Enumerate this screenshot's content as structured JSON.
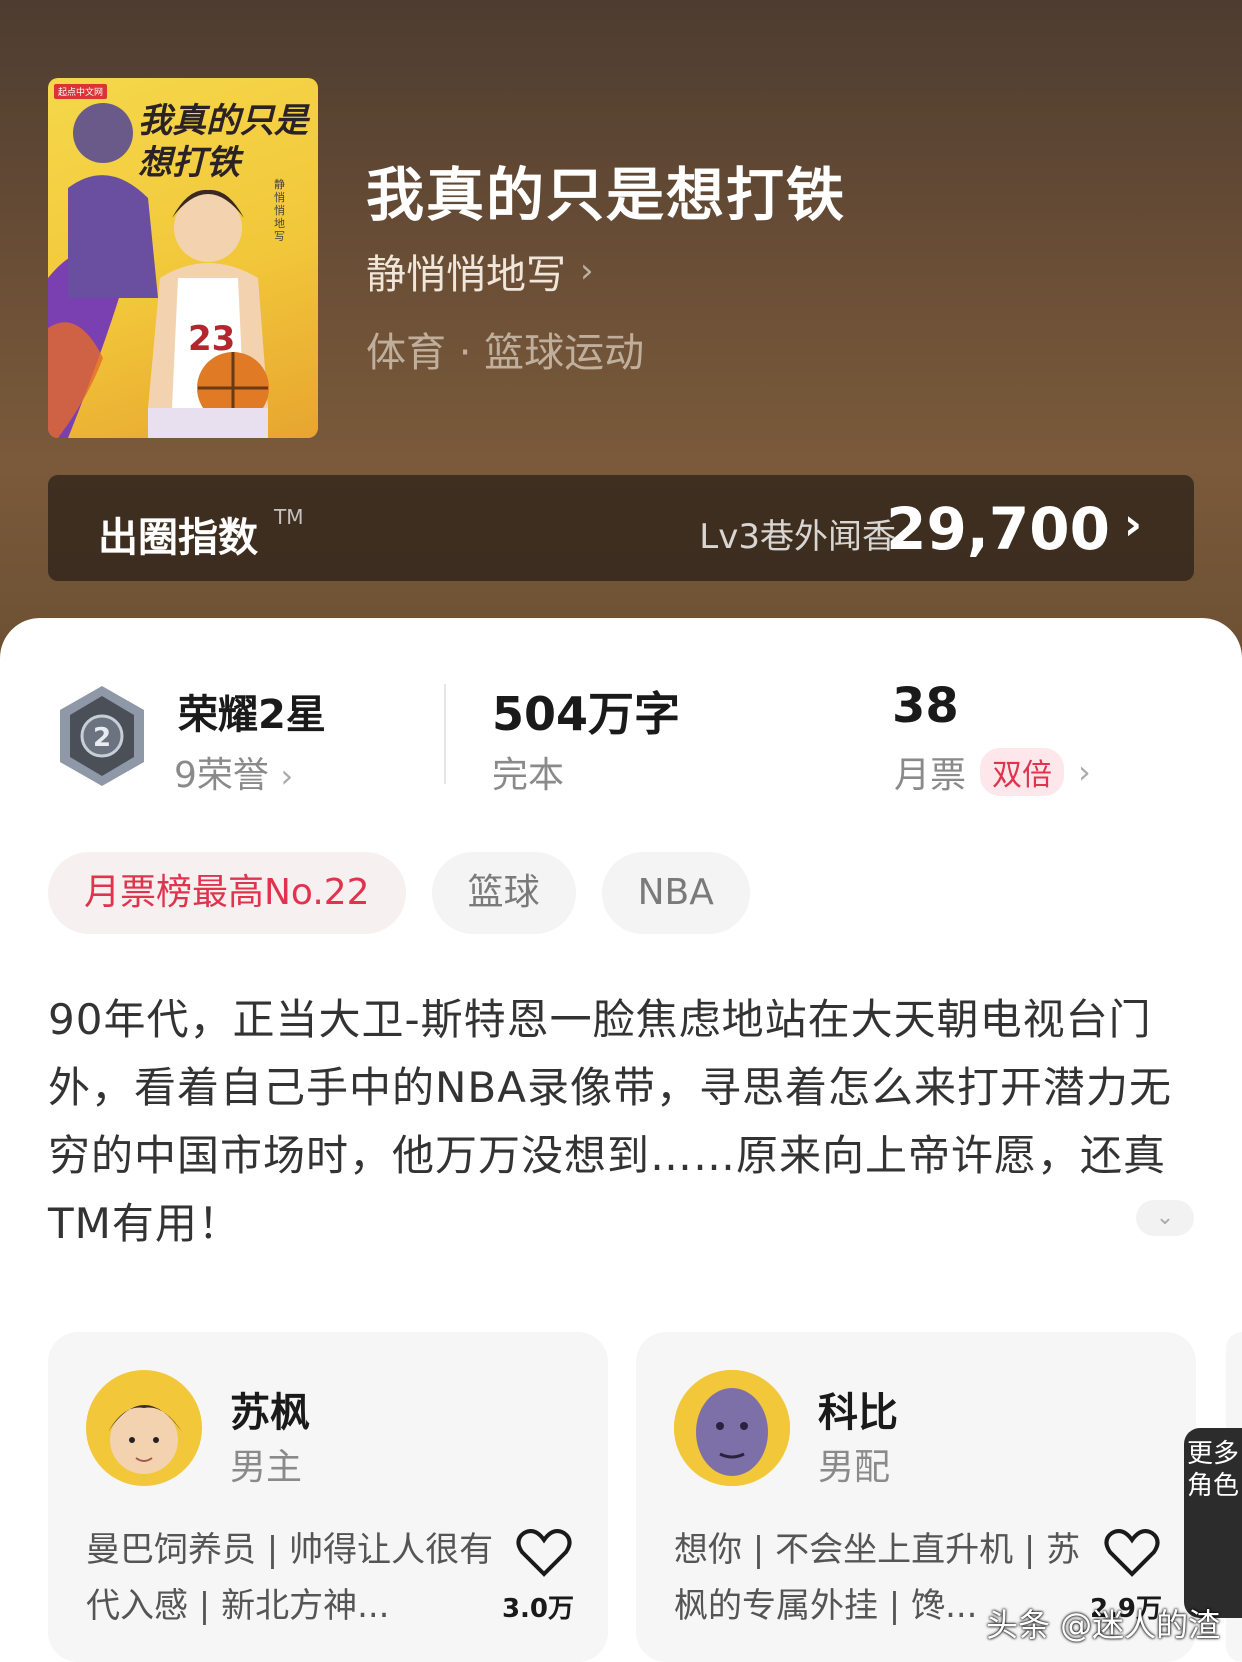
{
  "book": {
    "title": "我真的只是想打铁",
    "author": "静悄悄地写",
    "genre": "体育 · 篮球运动",
    "cover": {
      "publisher": "起点中文网",
      "title_art": "我真的只是想打铁",
      "author_art": "静悄悄地写",
      "jersey": "23"
    }
  },
  "index": {
    "label": "出圈指数",
    "tm": "TM",
    "level": "Lv3巷外闻香",
    "value": "29,700"
  },
  "stats": {
    "honor_title": "荣耀2星",
    "honor_count": "9荣誉",
    "medal_number": "2",
    "words": "504万字",
    "status": "完本",
    "votes": "38",
    "votes_label": "月票",
    "double_badge": "双倍"
  },
  "tags": [
    "月票榜最高No.22",
    "篮球",
    "NBA"
  ],
  "intro": "90年代，正当大卫-斯特恩一脸焦虑地站在大天朝电视台门外，看着自己手中的NBA录像带，寻思着怎么来打开潜力无穷的中国市场时，他万万没想到……原来向上帝许愿，还真TM有用！",
  "characters": [
    {
      "name": "苏枫",
      "role": "男主",
      "desc": "曼巴饲养员 | 帅得让人很有代入感 | 新北方神...",
      "likes": "3.0万"
    },
    {
      "name": "科比",
      "role": "男配",
      "desc": "想你 | 不会坐上直升机 | 苏枫的专属外挂 | 馋...",
      "likes": "2.9万"
    }
  ],
  "more_chars": "更多角色",
  "watermark": "头条 @迷人的渣",
  "colors": {
    "accent": "#e0344e",
    "hero_bg": "#6a4e36"
  }
}
